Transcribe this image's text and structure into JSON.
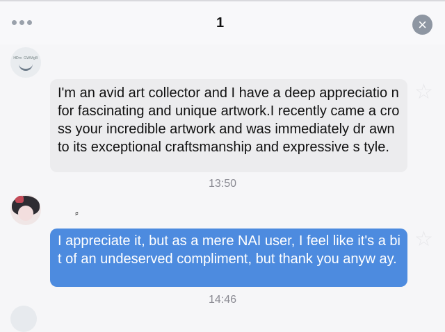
{
  "header": {
    "title": "1",
    "more_icon": "more-dots-icon",
    "close_icon": "close-icon"
  },
  "messages": [
    {
      "direction": "incoming",
      "avatar_text": "ᴴᴰᵐ ᴳᵂᴹᵍᴮ",
      "text": "I'm an avid art collector and I have a deep appreciatio n for fascinating and unique artwork.I recently came a cross your incredible artwork and was immediately dr awn to its exceptional craftsmanship and expressive s tyle.",
      "time": "13:50"
    },
    {
      "direction": "outgoing",
      "name_mark": "⸗",
      "text": "I appreciate it, but as a mere NAI user, I feel like it's a bit of an undeserved compliment, but thank you anyw ay.",
      "time": "14:46"
    }
  ],
  "colors": {
    "incoming_bubble": "#ececee",
    "outgoing_bubble": "#4d8bdf",
    "close_button": "#8e96a2"
  }
}
